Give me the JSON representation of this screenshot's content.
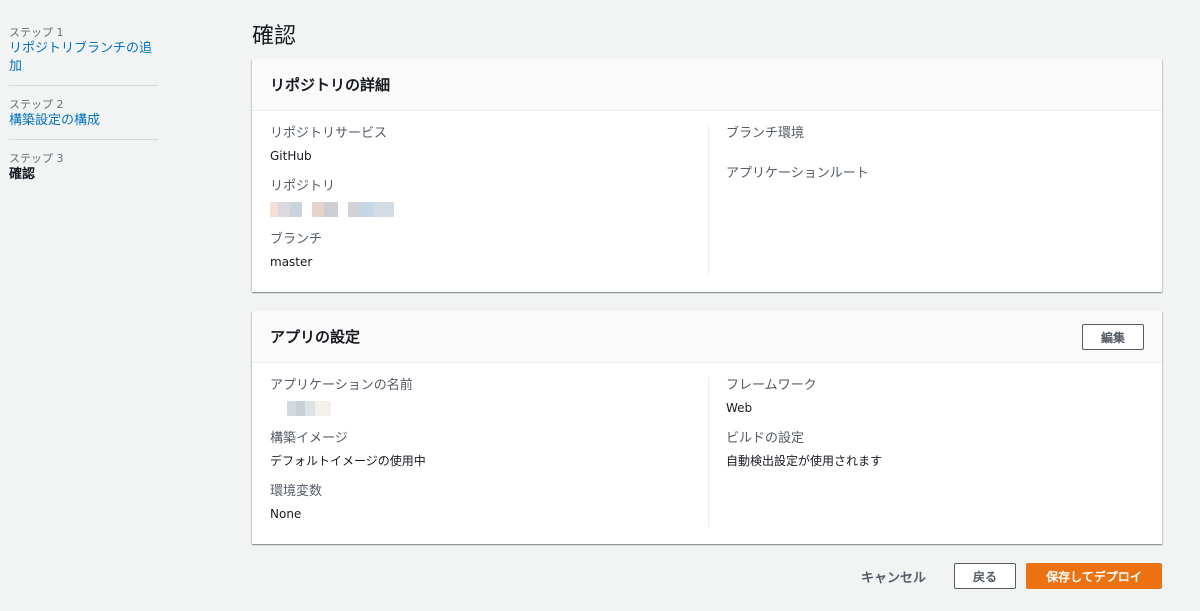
{
  "sidebar": {
    "steps": [
      {
        "num": "ステップ 1",
        "label": "リポジトリブランチの追加"
      },
      {
        "num": "ステップ 2",
        "label": "構築設定の構成"
      },
      {
        "num": "ステップ 3",
        "label": "確認"
      }
    ]
  },
  "page": {
    "title": "確認"
  },
  "repo_panel": {
    "title": "リポジトリの詳細",
    "left": [
      {
        "label": "リポジトリサービス",
        "value": "GitHub"
      },
      {
        "label": "リポジトリ",
        "value": ""
      },
      {
        "label": "ブランチ",
        "value": "master"
      }
    ],
    "right": [
      {
        "label": "ブランチ環境",
        "value": ""
      },
      {
        "label": "アプリケーションルート",
        "value": ""
      }
    ]
  },
  "app_panel": {
    "title": "アプリの設定",
    "edit_label": "編集",
    "left": [
      {
        "label": "アプリケーションの名前",
        "value": ""
      },
      {
        "label": "構築イメージ",
        "value": "デフォルトイメージの使用中"
      },
      {
        "label": "環境変数",
        "value": "None"
      }
    ],
    "right": [
      {
        "label": "フレームワーク",
        "value": "Web"
      },
      {
        "label": "ビルドの設定",
        "value": "自動検出設定が使用されます"
      }
    ]
  },
  "footer": {
    "cancel_label": "キャンセル",
    "back_label": "戻る",
    "deploy_label": "保存してデプロイ"
  },
  "colors": {
    "background": "#f2f3f3",
    "link": "#0073bb",
    "primary_button": "#ec7211",
    "panel_header": "#fafafa"
  }
}
